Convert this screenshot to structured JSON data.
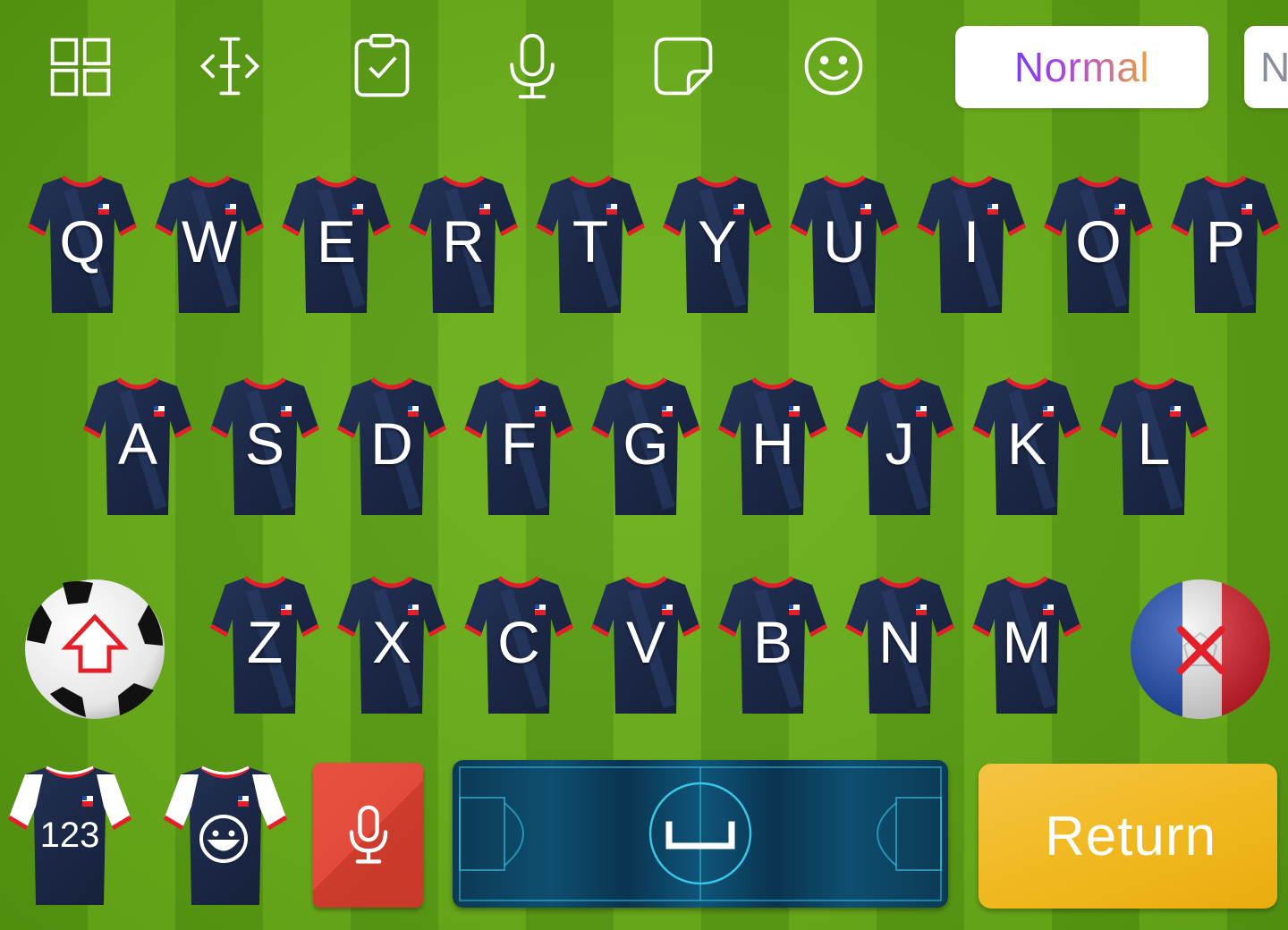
{
  "toolbar": {
    "icons": [
      {
        "name": "layout-grid-icon"
      },
      {
        "name": "text-cursor-icon"
      },
      {
        "name": "clipboard-icon"
      },
      {
        "name": "microphone-icon"
      },
      {
        "name": "sticker-icon"
      },
      {
        "name": "emoji-smile-icon"
      }
    ],
    "font_modes": [
      {
        "label": "Normal",
        "selected": true
      },
      {
        "label": "N",
        "selected": false
      }
    ]
  },
  "keyboard": {
    "row1": [
      "Q",
      "W",
      "E",
      "R",
      "T",
      "Y",
      "U",
      "I",
      "O",
      "P"
    ],
    "row2": [
      "A",
      "S",
      "D",
      "F",
      "G",
      "H",
      "J",
      "K",
      "L"
    ],
    "row3": [
      "Z",
      "X",
      "C",
      "V",
      "B",
      "N",
      "M"
    ],
    "shift": {
      "icon": "shift-arrow-icon"
    },
    "delete": {
      "icon": "delete-x-icon"
    },
    "numbers_label": "123",
    "emoji": {
      "icon": "emoji-face-icon"
    },
    "dictation": {
      "icon": "microphone-icon"
    },
    "space": {
      "icon": "space-bar-icon"
    },
    "return_label": "Return"
  },
  "colors": {
    "pitch_light": "#6bb018",
    "pitch_dark": "#5a9e12",
    "jersey_navy": "#1b2745",
    "jersey_trim": "#e3202a",
    "mic_key": "#e24b3b",
    "return_key": "#f0b81f"
  }
}
